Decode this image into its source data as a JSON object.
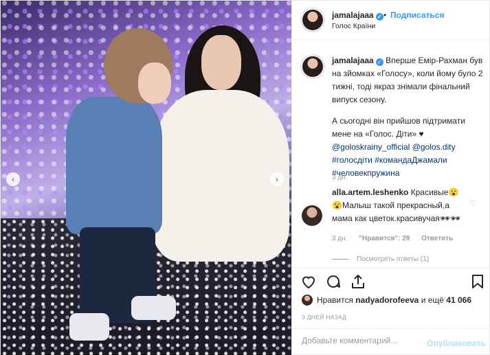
{
  "post": {
    "username": "jamalajaaa",
    "follow_label": "Подписаться",
    "dot": "•",
    "location": "Голос Країни"
  },
  "caption": {
    "username": "jamalajaaa",
    "text1": "Вперше Емір-Рахман був на зйомках «Голосу», коли йому було 2 тижні, тоді якраз знімали фінальний випуск сезону.",
    "text2": "А сьогодні він прийшов підтримати мене на «Голос. Діти» ♥",
    "mention1": "@goloskrainy_official",
    "mention2": "@golos.dity",
    "tag1": "#голосдіти",
    "tag2": "#командаДжамали",
    "tag3": "#человекпружина",
    "time": "3 дн."
  },
  "comment": {
    "username": "alla.artem.leshenko",
    "text": "Красивые😮😮Малыш такой прекрасный,а мама как цветок.красивучая🕶🕶",
    "time": "3 дн.",
    "likes": "\"Нравится\": 28",
    "reply_label": "Ответить",
    "show_replies": "Посмотреть ответы (1)"
  },
  "likes": {
    "prefix": "Нравится",
    "user": "nadyadorofeeva",
    "and": "и ещё",
    "count": "41 066"
  },
  "time_ago": "3 ДНЕЙ НАЗАД",
  "add_comment": {
    "placeholder": "Добавьте комментарий...",
    "publish_label": "Опубликовать"
  },
  "icons": {
    "heart": "heart-icon",
    "comment": "comment-icon",
    "share": "share-icon",
    "bookmark": "bookmark-icon"
  },
  "colors": {
    "accent": "#3897f0",
    "link": "#003569",
    "muted": "#999999",
    "publish_disabled": "#b2dffc"
  }
}
